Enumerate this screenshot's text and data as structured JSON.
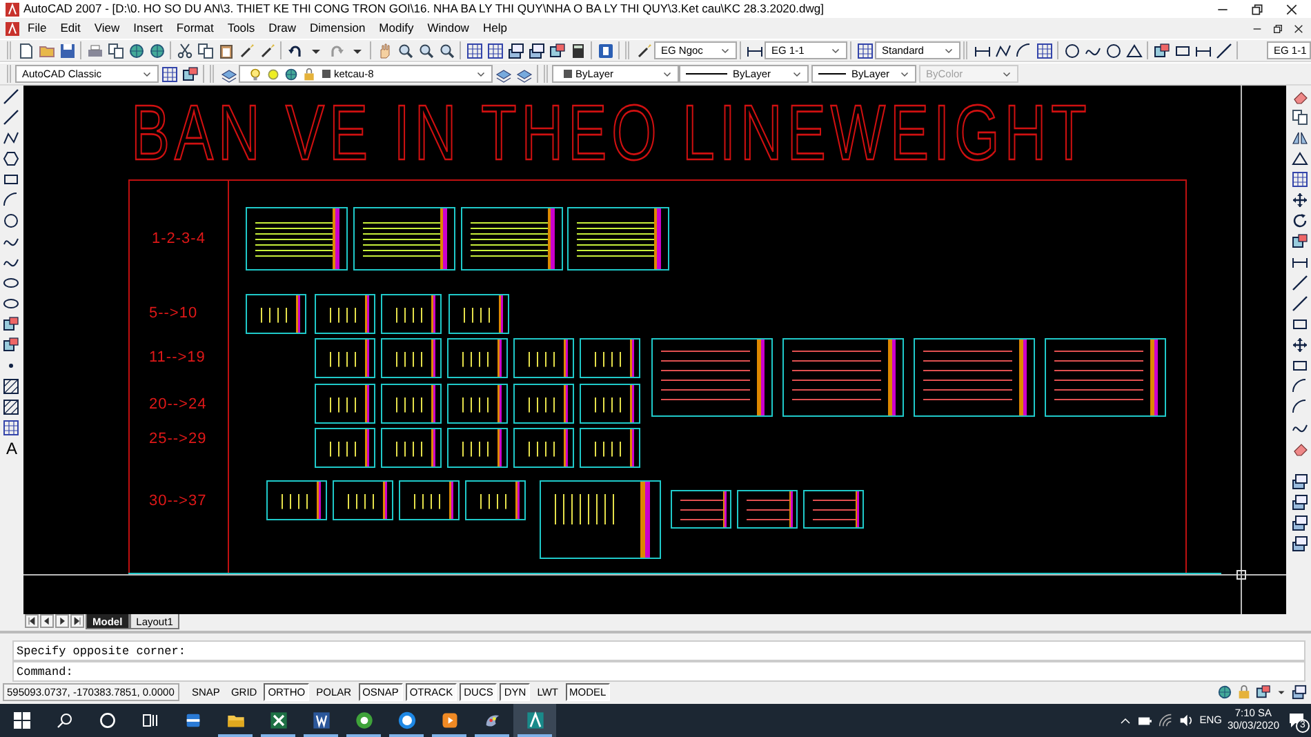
{
  "window": {
    "title": "AutoCAD 2007 - [D:\\0. HO SO DU AN\\3. THIET KE THI CONG TRON GOI\\16. NHA BA LY THI QUY\\NHA O BA LY THI QUY\\3.Ket cau\\KC 28.3.2020.dwg]"
  },
  "menu": [
    "File",
    "Edit",
    "View",
    "Insert",
    "Format",
    "Tools",
    "Draw",
    "Dimension",
    "Modify",
    "Window",
    "Help"
  ],
  "toolbar_1": {
    "text_style": "EG Ngoc",
    "dim_style": "EG 1-1",
    "table_style": "Standard",
    "dim_style_right": "EG 1-1"
  },
  "toolbar_2": {
    "workspace": "AutoCAD Classic",
    "layer": "ketcau-8",
    "color_control": "ByLayer",
    "linetype": "ByLayer",
    "lineweight": "ByLayer",
    "plot_style": {
      "value": "ByColor",
      "disabled": true
    }
  },
  "draw_toolbar": {
    "text_tool": "A"
  },
  "drawing": {
    "title": "BAN VE IN THEO LINEWEIGHT",
    "row_labels": [
      "1-2-3-4",
      "5-->10",
      "11-->19",
      "20-->24",
      "25-->29",
      "30-->37"
    ]
  },
  "layout_tabs": [
    {
      "label": "Model",
      "selected": true
    },
    {
      "label": "Layout1",
      "selected": false
    }
  ],
  "command_lines": [
    "Specify opposite corner:",
    "Command:"
  ],
  "status_bar": {
    "coordinates": "595093.0737, -170383.7851, 0.0000",
    "toggles": [
      {
        "label": "SNAP",
        "on": false
      },
      {
        "label": "GRID",
        "on": false
      },
      {
        "label": "ORTHO",
        "on": true
      },
      {
        "label": "POLAR",
        "on": false
      },
      {
        "label": "OSNAP",
        "on": true
      },
      {
        "label": "OTRACK",
        "on": true
      },
      {
        "label": "DUCS",
        "on": true
      },
      {
        "label": "DYN",
        "on": true
      },
      {
        "label": "LWT",
        "on": false
      },
      {
        "label": "MODEL",
        "on": true
      }
    ]
  },
  "taskbar": {
    "apps": [
      {
        "running": false,
        "selected": false
      },
      {
        "running": true,
        "selected": false
      },
      {
        "running": true,
        "selected": false
      },
      {
        "running": true,
        "selected": false
      },
      {
        "running": true,
        "selected": false
      },
      {
        "running": true,
        "selected": false
      },
      {
        "running": true,
        "selected": false
      },
      {
        "running": true,
        "selected": false
      },
      {
        "running": true,
        "selected": true
      }
    ],
    "language": "ENG",
    "time": "7:10 SA",
    "date": "30/03/2020",
    "notification_count": "3"
  }
}
